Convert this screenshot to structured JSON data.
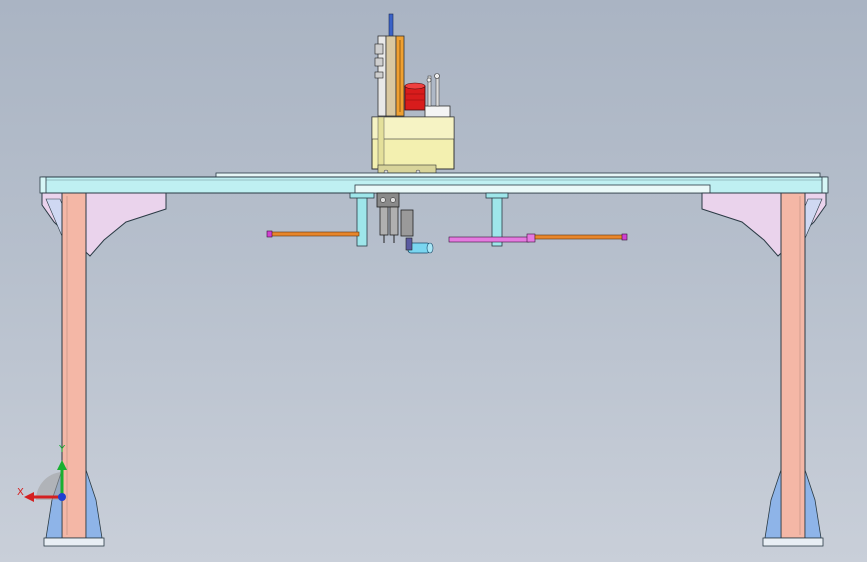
{
  "model_view": {
    "description_visible": false,
    "colors": {
      "background_top": "#aab4c3",
      "background_bottom": "#c9cfd9",
      "beam": "#bff0f2",
      "beam_outline": "#2a3a44",
      "leg": "#f4b7a6",
      "bracket": "#ead3ec",
      "hanger": "#9ee6ea",
      "rod": "#e8862a",
      "rod_pink": "#e57ae0",
      "carriage": "#f3f0b0",
      "motor": "#d81c1c",
      "base_foot": "#8eb4e8"
    },
    "triad": {
      "x_label": "X",
      "y_label": "Y",
      "x_color": "#d42020",
      "y_color": "#18b030",
      "z_color": "#2040d0"
    }
  }
}
